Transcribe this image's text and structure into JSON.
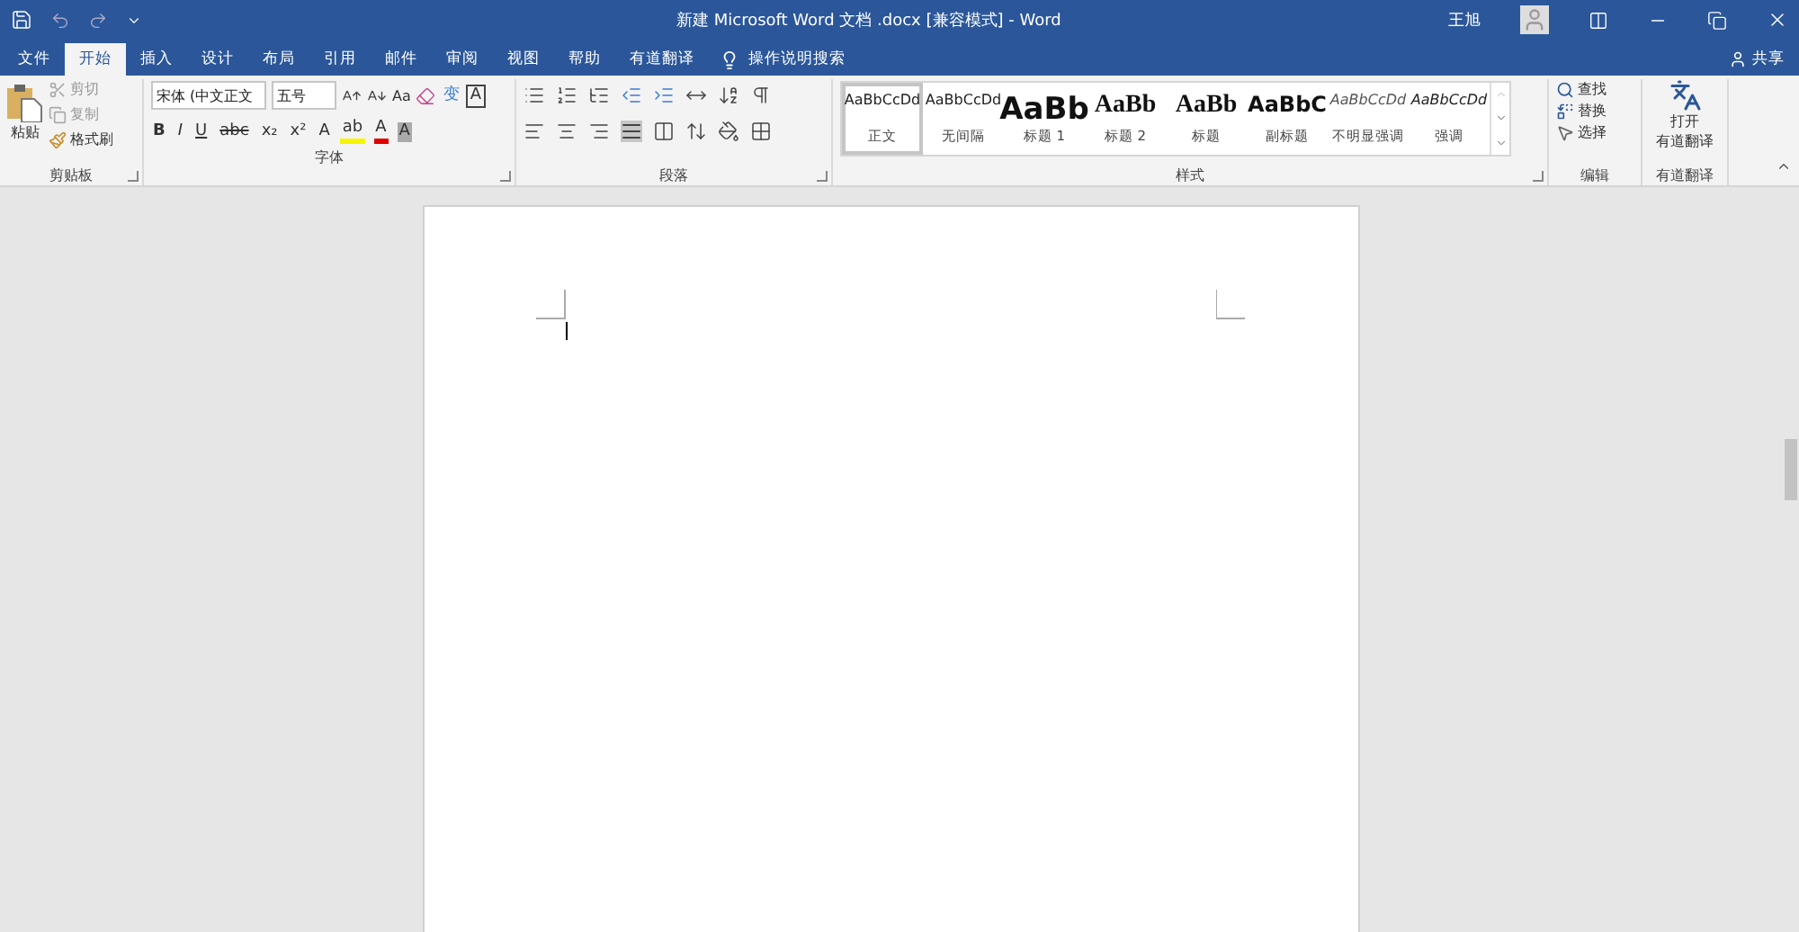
{
  "window": {
    "title": "新建 Microsoft Word 文档 .docx [兼容模式]  -  Word",
    "user": "王旭"
  },
  "tabs": [
    {
      "label": "文件",
      "selected": false
    },
    {
      "label": "开始",
      "selected": true
    },
    {
      "label": "插入",
      "selected": false
    },
    {
      "label": "设计",
      "selected": false
    },
    {
      "label": "布局",
      "selected": false
    },
    {
      "label": "引用",
      "selected": false
    },
    {
      "label": "邮件",
      "selected": false
    },
    {
      "label": "审阅",
      "selected": false
    },
    {
      "label": "视图",
      "selected": false
    },
    {
      "label": "帮助",
      "selected": false
    },
    {
      "label": "有道翻译",
      "selected": false
    }
  ],
  "tell_me": "操作说明搜索",
  "share": "共享",
  "clipboard": {
    "paste": "粘贴",
    "cut": "剪切",
    "copy": "复制",
    "format_painter": "格式刷",
    "label": "剪贴板"
  },
  "font": {
    "name": "宋体 (中文正文",
    "size": "五号",
    "case": "Aa",
    "phonetic": "变",
    "border": "A",
    "format_buttons": [
      {
        "kind": "bold",
        "label": "B"
      },
      {
        "kind": "italic",
        "label": "I"
      },
      {
        "kind": "underline",
        "label": "U"
      },
      {
        "kind": "strike",
        "label": "abc"
      },
      {
        "kind": "sub",
        "label": "x₂"
      },
      {
        "kind": "sup",
        "label": "x²"
      }
    ],
    "color_buttons": [
      {
        "kind": "effects",
        "label": "A"
      },
      {
        "kind": "highlight",
        "label": "ab"
      },
      {
        "kind": "color",
        "label": "A"
      },
      {
        "kind": "shading",
        "label": "A"
      }
    ],
    "label": "字体"
  },
  "paragraph": {
    "label": "段落"
  },
  "styles": {
    "items": [
      {
        "sample": "AaBbCcDd",
        "name": "正文",
        "kind": "normal",
        "selected": true
      },
      {
        "sample": "AaBbCcDd",
        "name": "无间隔",
        "kind": "normal",
        "selected": false
      },
      {
        "sample": "AaBb",
        "name": "标题 1",
        "kind": "heading1",
        "selected": false
      },
      {
        "sample": "AaBb",
        "name": "标题 2",
        "kind": "heading2",
        "selected": false
      },
      {
        "sample": "AaBb",
        "name": "标题",
        "kind": "heading2",
        "selected": false
      },
      {
        "sample": "AaBbC",
        "name": "副标题",
        "kind": "subtitle",
        "selected": false
      },
      {
        "sample": "AaBbCcDd",
        "name": "不明显强调",
        "kind": "subtle",
        "selected": false
      },
      {
        "sample": "AaBbCcDd",
        "name": "强调",
        "kind": "emphasis",
        "selected": false
      }
    ],
    "label": "样式"
  },
  "editing": {
    "find": "查找",
    "replace": "替换",
    "select": "选择",
    "label": "编辑"
  },
  "youdao": {
    "button_lines": [
      "打开",
      "有道翻译"
    ],
    "label": "有道翻译"
  }
}
